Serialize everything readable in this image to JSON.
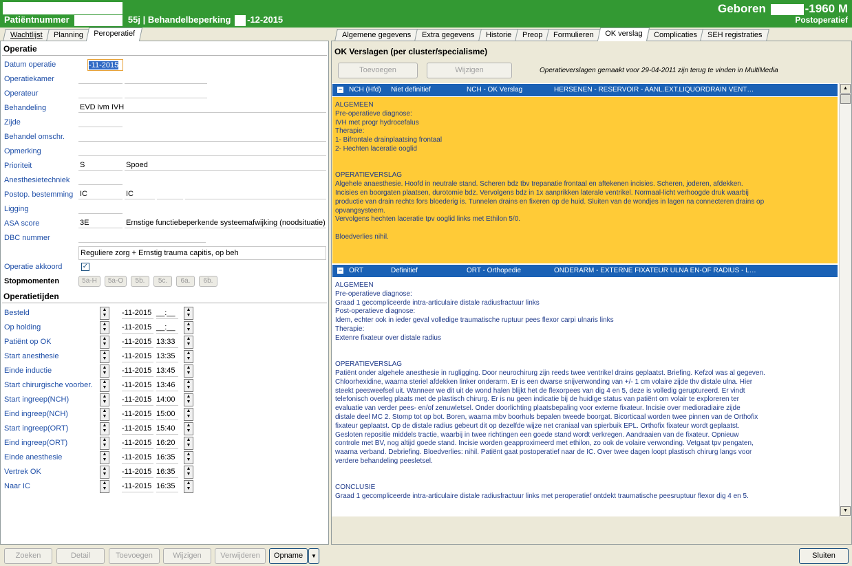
{
  "header": {
    "patient_label": "Patiëntnummer",
    "age": "55j",
    "behandel_label": "| Behandelbeperking",
    "behandel_date": "-12-2015",
    "geboren_label": "Geboren",
    "birth_year": "-1960 M",
    "status": "Postoperatief"
  },
  "left_tabs": [
    "Wachtlijst",
    "Planning",
    "Peroperatief"
  ],
  "right_tabs": [
    "Algemene gegevens",
    "Extra gegevens",
    "Historie",
    "Preop",
    "Formulieren",
    "OK verslag",
    "Complicaties",
    "SEH registraties"
  ],
  "operatie": {
    "title": "Operatie",
    "rows": [
      {
        "label": "Datum operatie"
      },
      {
        "label": "Operatiekamer"
      },
      {
        "label": "Operateur"
      },
      {
        "label": "Behandeling",
        "v1": "EVD ivm IVH"
      },
      {
        "label": "Zijde"
      },
      {
        "label": "Behandel omschr."
      },
      {
        "label": "Opmerking"
      },
      {
        "label": "Prioriteit",
        "v1": "S",
        "v2": "Spoed"
      },
      {
        "label": "Anesthesietechniek"
      },
      {
        "label": "Postop. bestemming",
        "v1": "IC",
        "v2": "IC"
      },
      {
        "label": "Ligging"
      },
      {
        "label": "ASA score",
        "v1": "3E",
        "v2": "Ernstige functiebeperkende systeemafwijking (noodsituatie)"
      },
      {
        "label": "DBC nummer"
      }
    ],
    "datum_value": "-11-2015",
    "dbc_text": "Reguliere zorg + Ernstig trauma capitis, op beh",
    "akkoord_label": "Operatie akkoord",
    "akkoord_check": "✓",
    "stop_label": "Stopmomenten",
    "stop_buttons": [
      "5a-H",
      "5a-O",
      "5b.",
      "5c.",
      "6a.",
      "6b."
    ]
  },
  "tijden": {
    "title": "Operatietijden",
    "rows": [
      {
        "label": "Besteld",
        "date": "-11-2015",
        "time": "__:__"
      },
      {
        "label": "Op holding",
        "date": "-11-2015",
        "time": "__:__"
      },
      {
        "label": "Patiënt op OK",
        "date": "-11-2015",
        "time": "13:33"
      },
      {
        "label": "Start anesthesie",
        "date": "-11-2015",
        "time": "13:35"
      },
      {
        "label": "Einde inductie",
        "date": "-11-2015",
        "time": "13:45"
      },
      {
        "label": "Start chirurgische voorber.",
        "date": "-11-2015",
        "time": "13:46"
      },
      {
        "label": "Start ingreep(NCH)",
        "date": "-11-2015",
        "time": "14:00"
      },
      {
        "label": "Eind ingreep(NCH)",
        "date": "-11-2015",
        "time": "15:00"
      },
      {
        "label": "Start ingreep(ORT)",
        "date": "-11-2015",
        "time": "15:40"
      },
      {
        "label": "Eind ingreep(ORT)",
        "date": "-11-2015",
        "time": "16:20"
      },
      {
        "label": "Einde anesthesie",
        "date": "-11-2015",
        "time": "16:35"
      },
      {
        "label": "Vertrek OK",
        "date": "-11-2015",
        "time": "16:35"
      },
      {
        "label": "Naar IC",
        "date": "-11-2015",
        "time": "16:35"
      }
    ]
  },
  "bottom_buttons": [
    "Zoeken",
    "Detail",
    "Toevoegen",
    "Wijzigen",
    "Verwijderen",
    "Opname",
    "Sluiten"
  ],
  "right": {
    "title": "OK Verslagen (per cluster/specialisme)",
    "btn_add": "Toevoegen",
    "btn_edit": "Wijzigen",
    "note": "Operatieverslagen gemaakt voor 29-04-2011 zijn terug te vinden in MultiMedia",
    "report1": {
      "code": "NCH (Hfd)",
      "status": "Niet definitief",
      "spec": "NCH - OK Verslag",
      "desc": "HERSENEN - RESERVOIR - AANL.EXT.LIQUORDRAIN VENT…",
      "body": "ALGEMEEN\nPre-operatieve diagnose:\nIVH met progr hydrocefalus\nTherapie:\n1- Bifrontale drainplaatsing frontaal\n2- Hechten laceratie ooglid\n\n\nOPERATIEVERSLAG\nAlgehele anaesthesie. Hoofd in neutrale stand. Scheren bdz tbv trepanatie frontaal en aftekenen incisies. Scheren, joderen, afdekken.\nIncisies en boorgaten plaatsen, durotomie bdz. Vervolgens bdz in 1x aanprikken laterale ventrikel. Normaal-licht verhoogde druk waarbij\nproductie van drain rechts fors bloederig is. Tunnelen drains en fixeren op de huid. Sluiten van de wondjes in lagen na connecteren drains op\nopvangsysteem.\nVervolgens hechten laceratie tpv ooglid links met Ethilon 5/0.\n\nBloedverlies nihil."
    },
    "report2": {
      "code": "ORT",
      "status": "Definitief",
      "spec": "ORT - Orthopedie",
      "desc": "ONDERARM - EXTERNE FIXATEUR ULNA EN-OF RADIUS - L…",
      "body": "ALGEMEEN\nPre-operatieve diagnose:\nGraad 1 gecompliceerde intra-articulaire distale radiusfractuur links\nPost-operatieve diagnose:\nIdem, echter ook in ieder geval volledige traumatische ruptuur pees flexor carpi ulnaris links\nTherapie:\nExtenre fixateur over distale radius\n\n\nOPERATIEVERSLAG\nPatiënt onder algehele anesthesie in rugligging. Door neurochirurg zijn reeds twee ventrikel drains geplaatst. Briefing. Kefzol was al gegeven.\nChloorhexidine, waarna steriel afdekken linker onderarm. Er is een dwarse snijverwonding van +/- 1 cm volaire zijde thv distale ulna. Hier\nsteekt peesweefsel uit. Wanneer we dit uit de wond halen blijkt het de flexorpees van dig 4 en 5, deze is volledig geruptureerd. Er vindt\ntelefonisch overleg plaats met de plastisch chirurg. Er is nu geen indicatie bij de huidige status van patiënt om volair te exploreren ter\nevaluatie van verder pees- en/of zenuwletsel. Onder doorlichting plaatsbepaling voor externe fixateur. Incisie over medioradiaire zijde\ndistale deel MC 2. Stomp tot op bot. Boren, waarna mbv boorhuls bepalen tweede boorgat. Bicorticaal worden twee pinnen van de Orthofix\nfixateur geplaatst. Op de distale radius gebeurt dit op dezelfde wijze net craniaal van spierbuik EPL. Orthofix fixateur wordt geplaatst.\nGesloten repositie middels tractie, waarbij in twee richtingen een goede stand wordt verkregen. Aandraaien van de fixateur. Opnieuw\ncontrole met BV, nog altijd goede stand. Incisie worden geapproximeerd met ethilon, zo ook de volaire verwonding. Vetgaat tpv pengaten,\nwaarna verband. Debriefing. Bloedverlies: nihil. Patiënt gaat postoperatief naar de IC. Over twee dagen loopt plastisch chirurg langs voor\nverdere behandeling peesletsel.\n\n\nCONCLUSIE\nGraad 1 gecompliceerde intra-articulaire distale radiusfractuur links met peroperatief ontdekt traumatische peesruptuur flexor dig 4 en 5."
    }
  }
}
